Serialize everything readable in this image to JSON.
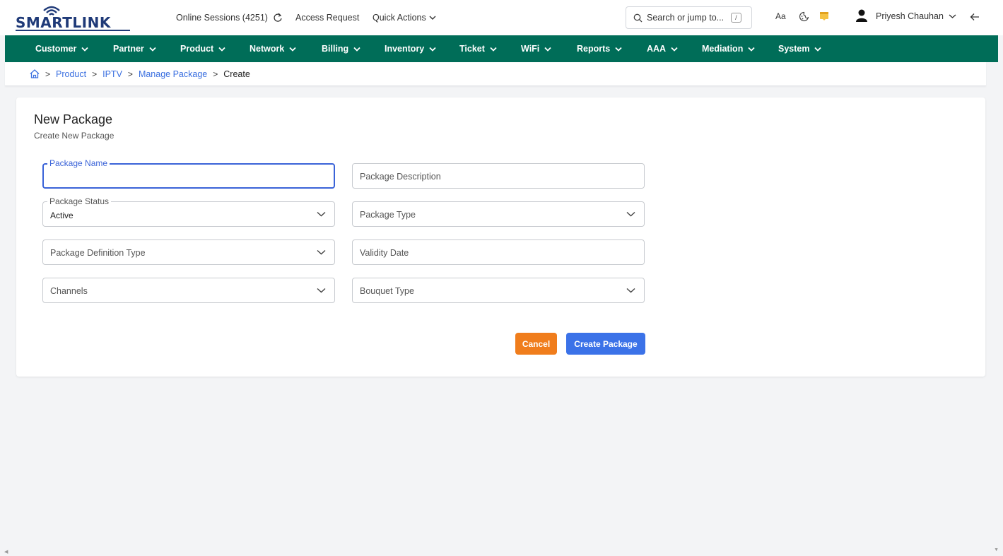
{
  "header": {
    "logo_text": "SMARTLINK",
    "online_sessions": "Online Sessions (4251)",
    "access_request": "Access Request",
    "quick_actions": "Quick Actions",
    "search_placeholder": "Search or jump to...",
    "search_shortcut": "/",
    "font_toggle": "Aa",
    "user_name": "Priyesh Chauhan"
  },
  "nav": {
    "items": [
      {
        "label": "Customer"
      },
      {
        "label": "Partner"
      },
      {
        "label": "Product"
      },
      {
        "label": "Network"
      },
      {
        "label": "Billing"
      },
      {
        "label": "Inventory"
      },
      {
        "label": "Ticket"
      },
      {
        "label": "WiFi"
      },
      {
        "label": "Reports"
      },
      {
        "label": "AAA"
      },
      {
        "label": "Mediation"
      },
      {
        "label": "System"
      }
    ]
  },
  "breadcrumb": {
    "items": [
      "Product",
      "IPTV",
      "Manage Package"
    ],
    "current": "Create"
  },
  "form": {
    "title": "New Package",
    "subtitle": "Create New Package",
    "package_name_label": "Package Name",
    "package_description_placeholder": "Package Description",
    "package_status_label": "Package Status",
    "package_status_value": "Active",
    "package_type_placeholder": "Package Type",
    "package_definition_type_placeholder": "Package Definition Type",
    "validity_date_placeholder": "Validity Date",
    "channels_placeholder": "Channels",
    "bouquet_type_placeholder": "Bouquet Type",
    "cancel_label": "Cancel",
    "create_label": "Create Package"
  },
  "colors": {
    "nav_bg": "#006d58",
    "primary": "#3b72e8",
    "cancel": "#f07d1c",
    "brand": "#1f3a78"
  }
}
